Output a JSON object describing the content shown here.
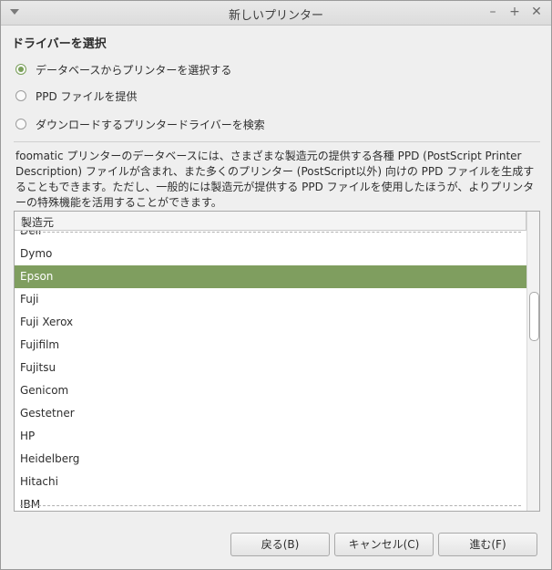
{
  "window": {
    "title": "新しいプリンター",
    "minimize": "–",
    "maximize": "+",
    "close": "✕"
  },
  "heading": "ドライバーを選択",
  "options": [
    {
      "label": "データベースからプリンターを選択する",
      "checked": true
    },
    {
      "label": "PPD ファイルを提供",
      "checked": false
    },
    {
      "label": "ダウンロードするプリンタードライバーを検索",
      "checked": false
    }
  ],
  "description": "foomatic プリンターのデータベースには、さまざまな製造元の提供する各種 PPD (PostScript Printer Description) ファイルが含まれ、また多くのプリンター (PostScript以外) 向けの PPD ファイルを生成することもできます。ただし、一般的には製造元が提供する PPD ファイルを使用したほうが、よりプリンターの特殊機能を活用することができます。",
  "list": {
    "column_header": "製造元",
    "items": [
      "Dell",
      "Dymo",
      "Epson",
      "Fuji",
      "Fuji Xerox",
      "Fujifilm",
      "Fujitsu",
      "Genicom",
      "Gestetner",
      "HP",
      "Heidelberg",
      "Hitachi",
      "IBM"
    ],
    "selected": "Epson"
  },
  "buttons": {
    "back": "戻る(B)",
    "cancel": "キャンセル(C)",
    "forward": "進む(F)"
  },
  "colors": {
    "accent": "#7f9e5f"
  }
}
